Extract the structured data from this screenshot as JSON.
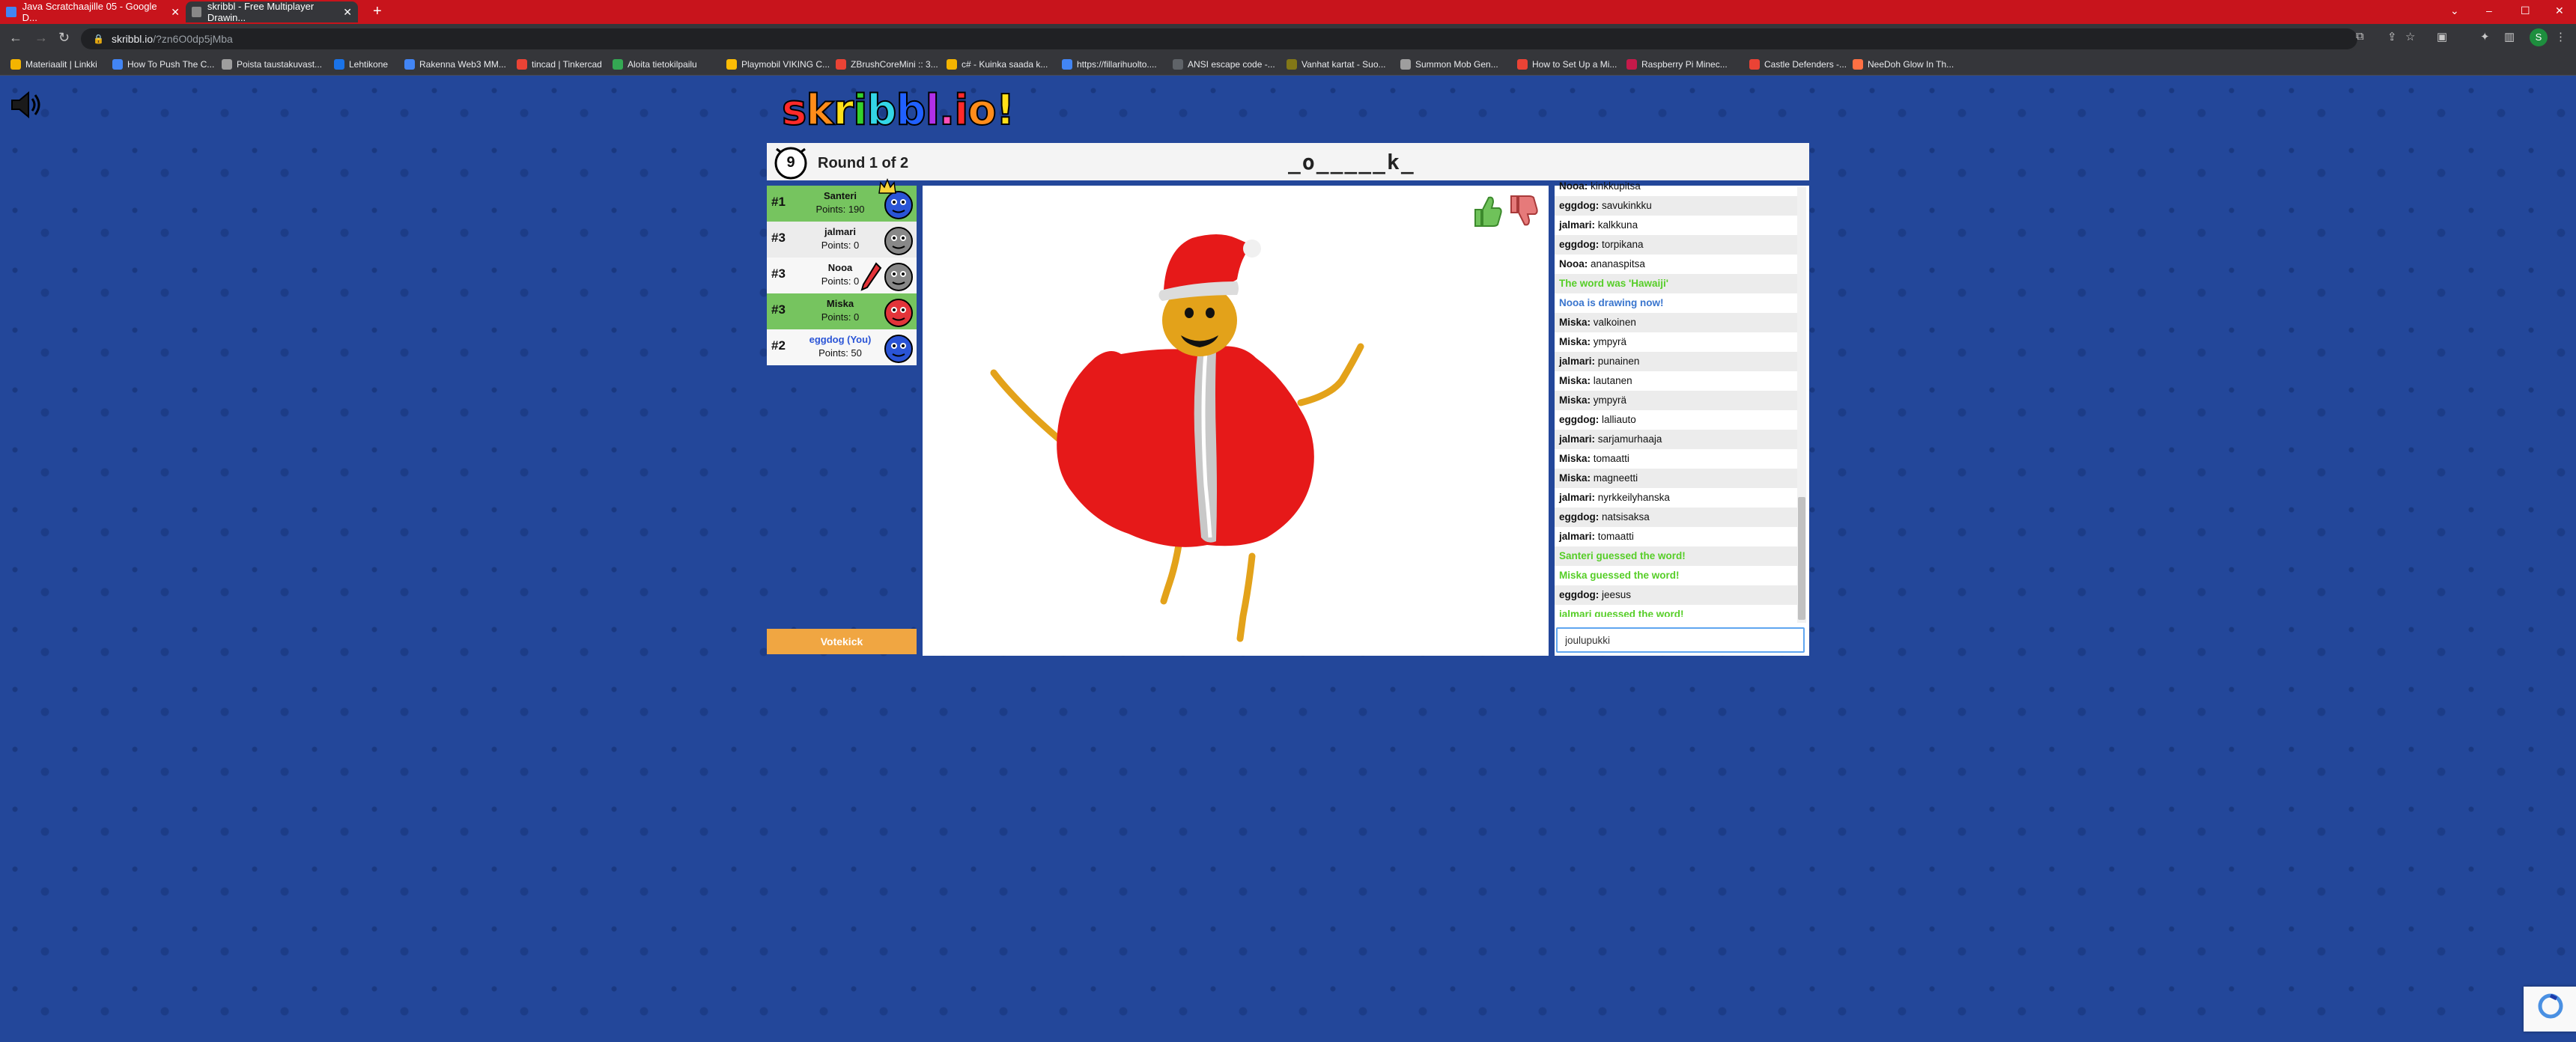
{
  "browser": {
    "tabs": [
      {
        "title": "Java Scratchaajille 05 - Google D...",
        "favicon_color": "#4285f4"
      },
      {
        "title": "skribbl - Free Multiplayer Drawin...",
        "favicon_color": "#888888"
      }
    ],
    "url_host": "skribbl.io",
    "url_path": "/?zn6O0dp5jMba",
    "profile_initial": "S",
    "bookmarks": [
      "Materiaalit | Linkki",
      "How To Push The C...",
      "Poista taustakuvast...",
      "Lehtikone",
      "Rakenna Web3 MM...",
      "tincad | Tinkercad",
      "Aloita tietokilpailu",
      "Playmobil VIKING C...",
      "ZBrushCoreMini :: 3...",
      "c# - Kuinka saada k...",
      "https://fillarihuolto....",
      "ANSI escape code -...",
      "Vanhat kartat - Suo...",
      "Summon Mob Gen...",
      "How to Set Up a Mi...",
      "Raspberry Pi Minec...",
      "Castle Defenders -...",
      "NeeDoh Glow In Th..."
    ]
  },
  "game": {
    "timer": "9",
    "round": "Round 1 of 2",
    "word_hint": "_o_____k_",
    "votekick": "Votekick",
    "players": [
      {
        "rank": "#1",
        "name": "Santeri",
        "points": "Points: 190",
        "bg": "#76c45f",
        "color": "#2a54d6",
        "name_color": "#111111"
      },
      {
        "rank": "#3",
        "name": "jalmari",
        "points": "Points: 0",
        "bg": "#ececec",
        "color": "#888888",
        "name_color": "#111111"
      },
      {
        "rank": "#3",
        "name": "Nooa",
        "points": "Points: 0",
        "bg": "#f7f7f7",
        "color": "#888888",
        "name_color": "#111111"
      },
      {
        "rank": "#3",
        "name": "Miska",
        "points": "Points: 0",
        "bg": "#76c45f",
        "color": "#e3343a",
        "name_color": "#111111"
      },
      {
        "rank": "#2",
        "name": "eggdog (You)",
        "points": "Points: 50",
        "bg": "#f7f7f7",
        "color": "#2a54d6",
        "name_color": "#2a54d6"
      }
    ],
    "chat": [
      {
        "user": "Nooa:",
        "text": "kinkkupitsa",
        "type": "normal"
      },
      {
        "user": "eggdog:",
        "text": "savukinkku",
        "type": "normal"
      },
      {
        "user": "jalmari:",
        "text": "kalkkuna",
        "type": "normal"
      },
      {
        "user": "eggdog:",
        "text": "torpikana",
        "type": "normal"
      },
      {
        "user": "Nooa:",
        "text": "ananaspitsa",
        "type": "normal"
      },
      {
        "user": "",
        "text": "The word was 'Hawaiji'",
        "type": "green"
      },
      {
        "user": "",
        "text": "Nooa is drawing now!",
        "type": "blue"
      },
      {
        "user": "Miska:",
        "text": "valkoinen",
        "type": "normal"
      },
      {
        "user": "Miska:",
        "text": "ympyrä",
        "type": "normal"
      },
      {
        "user": "jalmari:",
        "text": "punainen",
        "type": "normal"
      },
      {
        "user": "Miska:",
        "text": "lautanen",
        "type": "normal"
      },
      {
        "user": "Miska:",
        "text": "ympyrä",
        "type": "normal"
      },
      {
        "user": "eggdog:",
        "text": "lalliauto",
        "type": "normal"
      },
      {
        "user": "jalmari:",
        "text": "sarjamurhaaja",
        "type": "normal"
      },
      {
        "user": "Miska:",
        "text": "tomaatti",
        "type": "normal"
      },
      {
        "user": "Miska:",
        "text": "magneetti",
        "type": "normal"
      },
      {
        "user": "jalmari:",
        "text": "nyrkkeilyhanska",
        "type": "normal"
      },
      {
        "user": "eggdog:",
        "text": "natsisaksa",
        "type": "normal"
      },
      {
        "user": "jalmari:",
        "text": "tomaatti",
        "type": "normal"
      },
      {
        "user": "",
        "text": "Santeri guessed the word!",
        "type": "green"
      },
      {
        "user": "",
        "text": "Miska guessed the word!",
        "type": "green"
      },
      {
        "user": "eggdog:",
        "text": "jeesus",
        "type": "normal"
      },
      {
        "user": "",
        "text": "jalmari guessed the word!",
        "type": "green"
      }
    ],
    "chat_input_value": "joulupukki",
    "logo_letters": [
      {
        "ch": "s",
        "color": "#ff2a2a"
      },
      {
        "ch": "k",
        "color": "#ff8c1a"
      },
      {
        "ch": "r",
        "color": "#ffe019"
      },
      {
        "ch": "i",
        "color": "#34d12c"
      },
      {
        "ch": "b",
        "color": "#33d6e6"
      },
      {
        "ch": "b",
        "color": "#2060ff"
      },
      {
        "ch": "l",
        "color": "#b030e8"
      },
      {
        "ch": ".",
        "color": "#ff4fb8"
      },
      {
        "ch": "i",
        "color": "#ff2a2a"
      },
      {
        "ch": "o",
        "color": "#ff8c1a"
      },
      {
        "ch": "!",
        "color": "#ffe019"
      }
    ]
  }
}
